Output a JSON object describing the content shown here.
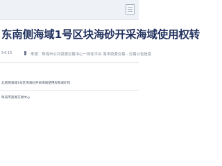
{
  "header": {
    "icon": "document-icon"
  },
  "article": {
    "title": "东南侧海域1号区块海砂开采海域使用权转",
    "time": "54:15",
    "source": "来源：珠海市公共资源交易中心一体化平台  海洋资源交易 - 交易公告信息"
  },
  "related": {
    "link_text": "北南侧海域1号区块海砂开采海域使用权和采矿权",
    "footer_text": "珠海市资源交易中心"
  }
}
